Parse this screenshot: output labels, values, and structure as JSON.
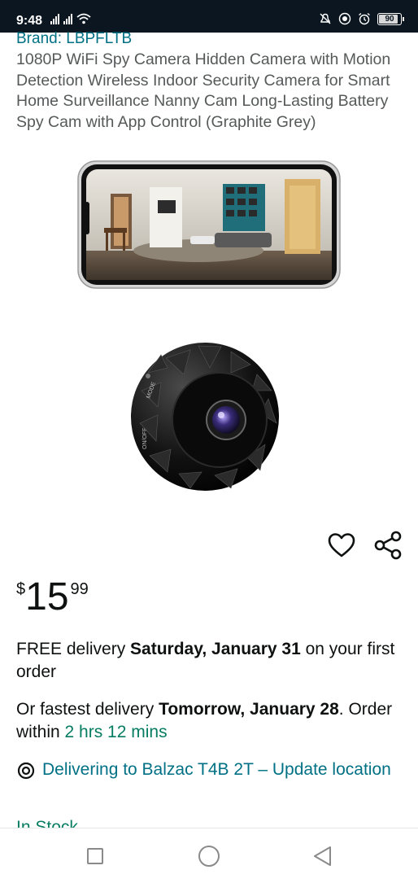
{
  "status_bar": {
    "time": "9:48",
    "battery": "90",
    "battery_level_percent": 90,
    "icons": [
      "signal-icon",
      "signal-icon",
      "wifi-icon",
      "mute-icon",
      "data-saver-icon",
      "alarm-icon",
      "battery-icon"
    ]
  },
  "product": {
    "brand": "Brand: LBPFLTB",
    "title": "1080P WiFi Spy Camera Hidden Camera with Motion Detection Wireless Indoor Security Camera for Smart Home Surveillance Nanny Cam Long-Lasting Battery Spy Cam with App Control (Graphite Grey)",
    "camera_labels": {
      "mode": "MODE",
      "onoff": "ON/OFF"
    }
  },
  "actions": {
    "wishlist_icon": "heart-icon",
    "share_icon": "share-icon"
  },
  "price": {
    "symbol": "$",
    "whole": "15",
    "fraction": "99"
  },
  "delivery": {
    "free_prefix": "FREE delivery ",
    "free_date": "Saturday, January 31",
    "free_suffix": " on your first order",
    "fastest_prefix": "Or fastest delivery ",
    "fastest_date": "Tomorrow, January 28",
    "fastest_mid": ". Order within ",
    "countdown": "2 hrs 12 mins"
  },
  "location": {
    "icon": "location-pin-icon",
    "text": "Delivering to Balzac T4B 2T – Update location"
  },
  "stock": "In Stock",
  "colors": {
    "link": "#007185",
    "success": "#067d62",
    "title_text": "#565959",
    "status_bar": "#0b1620"
  },
  "nav_bar": {
    "icons": [
      "recent-apps-icon",
      "home-icon",
      "back-icon"
    ]
  }
}
